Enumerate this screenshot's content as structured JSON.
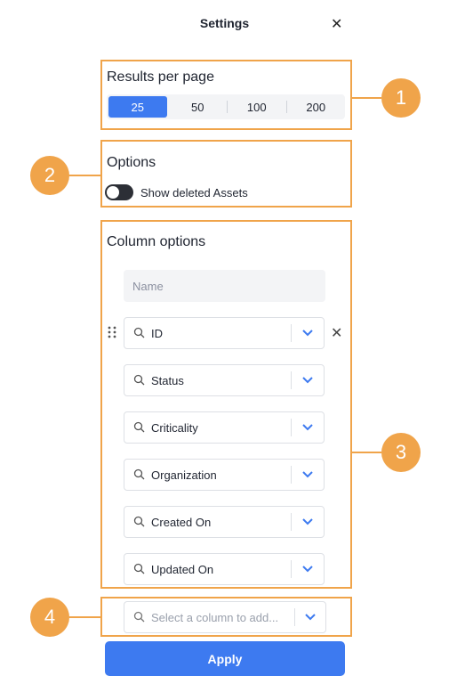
{
  "header": {
    "title": "Settings",
    "close_icon": "close-icon"
  },
  "results_per_page": {
    "title": "Results per page",
    "options": [
      "25",
      "50",
      "100",
      "200"
    ],
    "selected": "25",
    "accent": "#3d7af0"
  },
  "options": {
    "title": "Options",
    "toggle_label": "Show deleted Assets",
    "toggle_on": false
  },
  "column_options": {
    "title": "Column options",
    "name_placeholder": "Name",
    "columns": [
      {
        "label": "ID"
      },
      {
        "label": "Status"
      },
      {
        "label": "Criticality"
      },
      {
        "label": "Organization"
      },
      {
        "label": "Created On"
      },
      {
        "label": "Updated On"
      }
    ],
    "add_placeholder": "Select a column to add..."
  },
  "annotations": [
    "1",
    "2",
    "3",
    "4"
  ],
  "apply_label": "Apply",
  "colors": {
    "annotation": "#f0a44a",
    "primary": "#3d7af0"
  }
}
